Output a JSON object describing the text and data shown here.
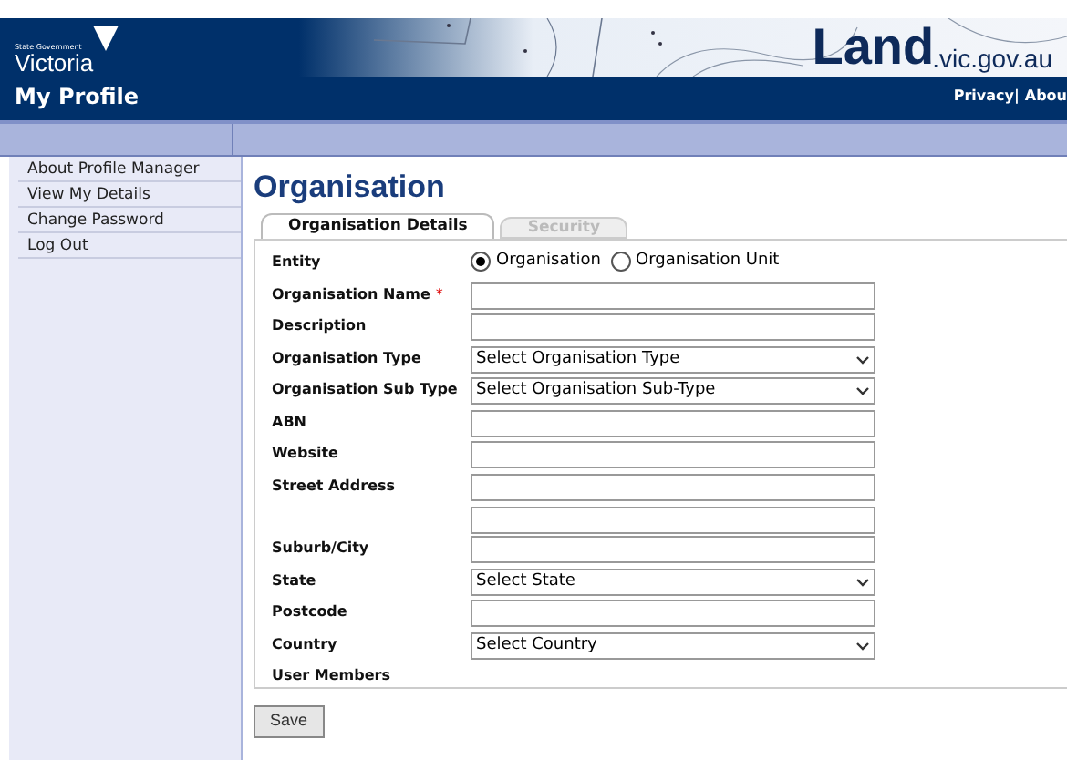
{
  "header": {
    "gov_label": "State Government",
    "gov_name": "Victoria",
    "logo_main": "Land",
    "logo_domain": ".vic.gov.au",
    "title": "My Profile",
    "links": [
      "Privacy|",
      "Abou"
    ]
  },
  "sidebar": {
    "items": [
      {
        "label": "About Profile Manager"
      },
      {
        "label": "View My Details"
      },
      {
        "label": "Change Password"
      },
      {
        "label": "Log Out"
      }
    ]
  },
  "page": {
    "heading": "Organisation",
    "tabs": [
      {
        "label": "Organisation Details",
        "selected": true
      },
      {
        "label": "Security",
        "selected": false
      }
    ],
    "fields": [
      {
        "label": "Entity",
        "kind": "radio",
        "options": [
          {
            "label": "Organisation",
            "selected": true
          },
          {
            "label": "Organisation Unit",
            "selected": false
          }
        ]
      },
      {
        "label": "Organisation Name",
        "kind": "text",
        "required_mark": "*"
      },
      {
        "label": "Description",
        "kind": "text"
      },
      {
        "label": "Organisation Type",
        "kind": "select",
        "value": "Select Organisation Type"
      },
      {
        "label": "Organisation Sub Type",
        "kind": "select",
        "value": "Select Organisation Sub-Type"
      },
      {
        "label": "ABN",
        "kind": "text"
      },
      {
        "label": "Website",
        "kind": "text"
      },
      {
        "label": "Street Address",
        "kind": "text2"
      },
      {
        "label": "Suburb/City",
        "kind": "text"
      },
      {
        "label": "State",
        "kind": "select",
        "value": "Select State"
      },
      {
        "label": "Postcode",
        "kind": "text"
      },
      {
        "label": "Country",
        "kind": "select",
        "value": "Select Country"
      },
      {
        "label": "User Members",
        "kind": "none"
      }
    ],
    "save": "Save"
  }
}
